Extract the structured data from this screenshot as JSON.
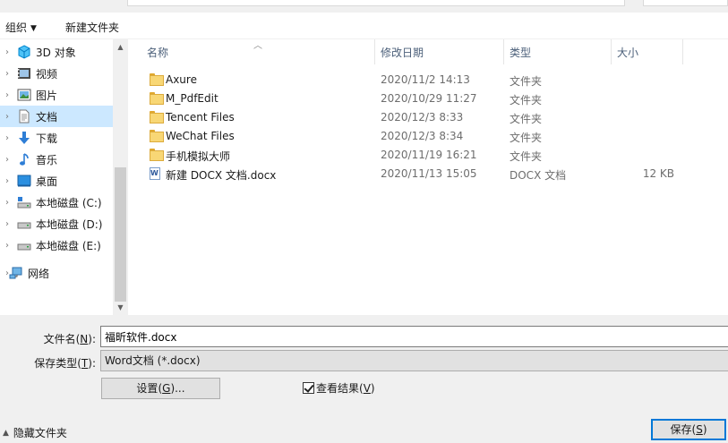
{
  "toolbar": {
    "organize_label": "组织",
    "new_folder_label": "新建文件夹"
  },
  "nav": {
    "items": [
      {
        "label": "3D 对象",
        "icon": "3d-objects-icon"
      },
      {
        "label": "视频",
        "icon": "video-icon"
      },
      {
        "label": "图片",
        "icon": "pictures-icon"
      },
      {
        "label": "文档",
        "icon": "documents-icon",
        "selected": true
      },
      {
        "label": "下载",
        "icon": "download-icon"
      },
      {
        "label": "音乐",
        "icon": "music-icon"
      },
      {
        "label": "桌面",
        "icon": "desktop-icon"
      },
      {
        "label": "本地磁盘 (C:)",
        "icon": "drive-c-icon"
      },
      {
        "label": "本地磁盘 (D:)",
        "icon": "drive-icon"
      },
      {
        "label": "本地磁盘 (E:)",
        "icon": "drive-icon"
      },
      {
        "label": "网络",
        "icon": "network-icon"
      }
    ]
  },
  "columns": {
    "name": "名称",
    "date": "修改日期",
    "type": "类型",
    "size": "大小"
  },
  "files": [
    {
      "name": "Axure",
      "date": "2020/11/2 14:13",
      "type": "文件夹",
      "size": "",
      "icon": "folder-icon"
    },
    {
      "name": "M_PdfEdit",
      "date": "2020/10/29 11:27",
      "type": "文件夹",
      "size": "",
      "icon": "folder-icon"
    },
    {
      "name": "Tencent Files",
      "date": "2020/12/3 8:33",
      "type": "文件夹",
      "size": "",
      "icon": "folder-icon"
    },
    {
      "name": "WeChat Files",
      "date": "2020/12/3 8:34",
      "type": "文件夹",
      "size": "",
      "icon": "folder-icon"
    },
    {
      "name": "手机模拟大师",
      "date": "2020/11/19 16:21",
      "type": "文件夹",
      "size": "",
      "icon": "folder-icon"
    },
    {
      "name": "新建 DOCX 文档.docx",
      "date": "2020/11/13 15:05",
      "type": "DOCX 文档",
      "size": "12 KB",
      "icon": "docx-file-icon"
    }
  ],
  "form": {
    "filename_label": "文件名",
    "filename_key": "N",
    "filename_value": "福昕软件.docx",
    "filetype_label": "保存类型",
    "filetype_key": "T",
    "filetype_value": "Word文档 (*.docx)",
    "settings_label": "设置",
    "settings_key": "G",
    "view_result_label": "查看结果",
    "view_result_key": "V",
    "view_result_checked": true,
    "hide_folders_label": "隐藏文件夹",
    "save_label": "保存",
    "save_key": "S"
  }
}
